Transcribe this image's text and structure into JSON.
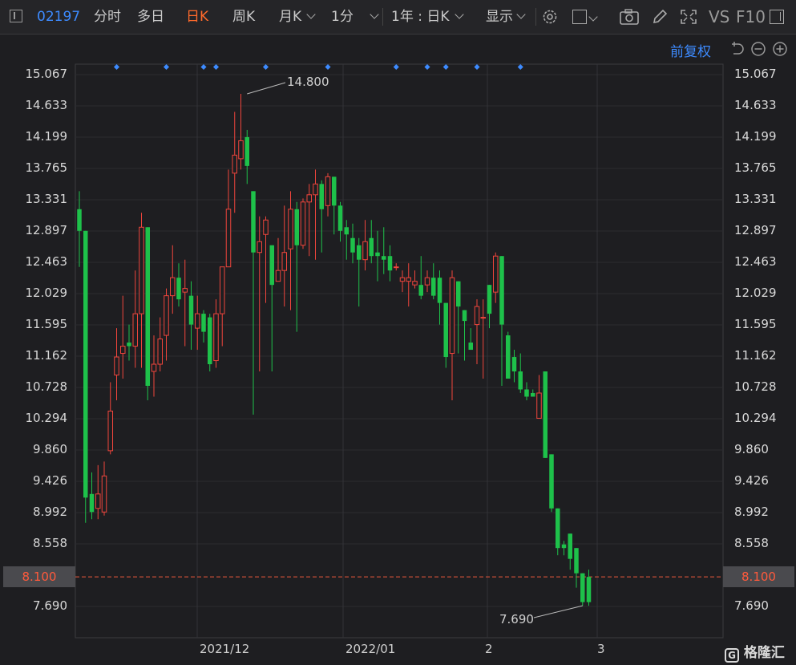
{
  "toolbar": {
    "stock_code": "02197",
    "tabs": [
      {
        "label": "分时"
      },
      {
        "label": "多日"
      },
      {
        "label": "日K"
      },
      {
        "label": "周K"
      },
      {
        "label": "月K"
      },
      {
        "label": "1分"
      }
    ],
    "period_select": "1年 : 日K",
    "display_label": "显示",
    "vs_label": "VS",
    "f10_label": "F10"
  },
  "adjust_label": "前复权",
  "colors": {
    "up": "#f0453c",
    "down": "#1ec14a",
    "accent": "#3d8bff",
    "active_tab": "#ff6a2b"
  },
  "chart_data": {
    "type": "candlestick",
    "y_ticks": [
      "15.067",
      "14.633",
      "14.199",
      "13.765",
      "13.331",
      "12.897",
      "12.463",
      "12.029",
      "11.595",
      "11.162",
      "10.728",
      "10.294",
      "9.860",
      "9.426",
      "8.992",
      "8.558",
      "7.690"
    ],
    "current_price_label": "8.100",
    "current_price": 8.1,
    "max_label": "14.800",
    "min_label": "7.690",
    "x_labels": [
      "2021/12",
      "2022/01",
      "2",
      "3"
    ],
    "ylim": [
      7.25,
      15.25
    ],
    "candles": [
      [
        13.2,
        12.9,
        13.45,
        12.4
      ],
      [
        12.9,
        9.2,
        12.9,
        8.85
      ],
      [
        9.25,
        9.0,
        9.55,
        8.9
      ],
      [
        9.05,
        9.25,
        9.65,
        8.9
      ],
      [
        9.0,
        9.5,
        9.7,
        8.95
      ],
      [
        9.85,
        10.4,
        10.8,
        9.8
      ],
      [
        10.9,
        11.15,
        11.55,
        10.55
      ],
      [
        11.2,
        11.3,
        12.0,
        10.85
      ],
      [
        11.35,
        11.3,
        11.6,
        11.1
      ],
      [
        11.3,
        11.75,
        12.35,
        11.0
      ],
      [
        11.75,
        12.95,
        13.15,
        11.0
      ],
      [
        12.95,
        10.75,
        12.95,
        10.55
      ],
      [
        10.95,
        11.05,
        11.45,
        10.6
      ],
      [
        11.05,
        11.4,
        11.7,
        10.95
      ],
      [
        11.45,
        12.0,
        12.1,
        11.1
      ],
      [
        12.0,
        12.25,
        12.7,
        11.75
      ],
      [
        12.25,
        11.95,
        12.45,
        11.85
      ],
      [
        12.05,
        12.1,
        12.5,
        11.3
      ],
      [
        12.0,
        11.6,
        12.2,
        11.25
      ],
      [
        11.55,
        11.75,
        12.0,
        11.25
      ],
      [
        11.75,
        11.5,
        11.8,
        11.35
      ],
      [
        11.7,
        11.05,
        11.75,
        10.95
      ],
      [
        11.1,
        11.75,
        11.95,
        11.0
      ],
      [
        11.75,
        12.4,
        12.4,
        11.3
      ],
      [
        12.4,
        13.2,
        13.75,
        12.4
      ],
      [
        13.7,
        13.95,
        14.55,
        13.15
      ],
      [
        13.9,
        14.15,
        14.8,
        13.75
      ],
      [
        14.2,
        13.8,
        14.3,
        13.55
      ],
      [
        13.45,
        12.6,
        13.45,
        10.35
      ],
      [
        12.6,
        12.75,
        13.1,
        10.95
      ],
      [
        12.85,
        13.05,
        13.1,
        11.9
      ],
      [
        12.7,
        12.15,
        12.7,
        10.95
      ],
      [
        12.2,
        12.35,
        12.8,
        12.2
      ],
      [
        12.35,
        12.6,
        13.25,
        11.85
      ],
      [
        12.65,
        13.2,
        13.45,
        11.8
      ],
      [
        13.2,
        12.7,
        13.3,
        11.5
      ],
      [
        12.7,
        13.3,
        13.35,
        12.65
      ],
      [
        13.3,
        13.4,
        13.55,
        12.55
      ],
      [
        13.4,
        13.55,
        13.75,
        12.5
      ],
      [
        13.55,
        13.2,
        13.6,
        12.6
      ],
      [
        13.25,
        13.65,
        13.7,
        13.1
      ],
      [
        13.65,
        13.25,
        13.65,
        12.85
      ],
      [
        13.25,
        12.9,
        13.3,
        12.75
      ],
      [
        12.95,
        12.85,
        13.05,
        12.5
      ],
      [
        12.8,
        12.6,
        13.0,
        12.45
      ],
      [
        12.7,
        12.5,
        12.8,
        11.85
      ],
      [
        12.5,
        12.75,
        13.05,
        12.35
      ],
      [
        12.8,
        12.55,
        13.05,
        12.45
      ],
      [
        12.6,
        12.55,
        12.9,
        12.2
      ],
      [
        12.55,
        12.5,
        12.95,
        12.3
      ],
      [
        12.55,
        12.35,
        12.7,
        12.2
      ],
      [
        12.4,
        12.4,
        12.45,
        12.35
      ],
      [
        12.2,
        12.25,
        12.35,
        12.05
      ],
      [
        12.2,
        12.25,
        12.45,
        11.85
      ],
      [
        12.15,
        12.2,
        12.35,
        12.1
      ],
      [
        12.15,
        12.0,
        12.55,
        11.95
      ],
      [
        12.15,
        12.25,
        12.35,
        12.05
      ],
      [
        12.25,
        12.0,
        12.45,
        11.95
      ],
      [
        12.25,
        11.9,
        12.35,
        11.6
      ],
      [
        11.9,
        11.15,
        11.9,
        11.0
      ],
      [
        11.2,
        12.25,
        12.35,
        10.55
      ],
      [
        12.2,
        11.85,
        12.2,
        11.2
      ],
      [
        11.8,
        11.65,
        11.8,
        11.1
      ],
      [
        11.35,
        11.25,
        11.55,
        11.25
      ],
      [
        11.6,
        11.85,
        11.95,
        11.05
      ],
      [
        11.7,
        11.7,
        11.95,
        10.85
      ],
      [
        12.15,
        11.75,
        12.15,
        11.55
      ],
      [
        12.05,
        12.55,
        12.6,
        11.9
      ],
      [
        12.55,
        11.6,
        12.55,
        10.75
      ],
      [
        11.45,
        10.85,
        11.5,
        10.85
      ],
      [
        11.15,
        10.95,
        11.25,
        10.8
      ],
      [
        10.95,
        10.7,
        11.2,
        10.65
      ],
      [
        10.7,
        10.6,
        10.8,
        10.55
      ],
      [
        10.65,
        10.6,
        10.7,
        10.6
      ],
      [
        10.3,
        10.65,
        10.9,
        10.3
      ],
      [
        10.95,
        9.75,
        10.95,
        9.75
      ],
      [
        9.8,
        9.05,
        9.8,
        9.0
      ],
      [
        9.05,
        8.5,
        9.05,
        8.4
      ],
      [
        8.55,
        8.5,
        8.6,
        8.4
      ],
      [
        8.7,
        8.35,
        8.7,
        8.2
      ],
      [
        8.5,
        8.15,
        8.5,
        7.95
      ],
      [
        8.15,
        7.75,
        8.15,
        7.7
      ],
      [
        8.1,
        7.75,
        8.2,
        7.7
      ]
    ],
    "markers": [
      6,
      14,
      20,
      22,
      30,
      40,
      51,
      56,
      59,
      64,
      71
    ]
  }
}
